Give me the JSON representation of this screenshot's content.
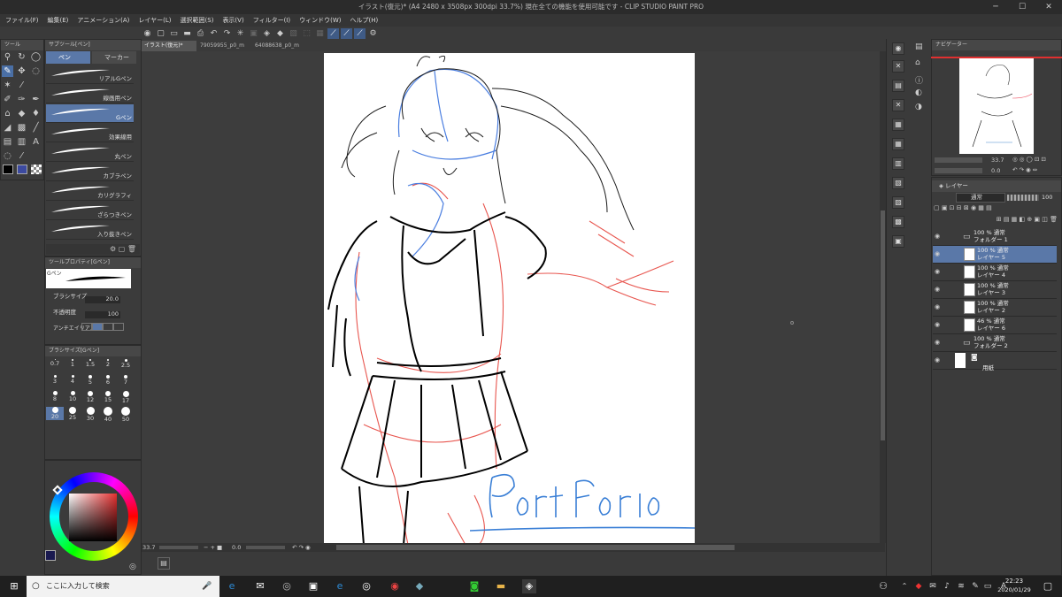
{
  "window": {
    "title": "イラスト(復元)* (A4 2480 x 3508px 300dpi 33.7%)  現在全ての機能を使用可能です - CLIP STUDIO PAINT PRO"
  },
  "menu": [
    "ファイル(F)",
    "編集(E)",
    "アニメーション(A)",
    "レイヤー(L)",
    "選択範囲(S)",
    "表示(V)",
    "フィルター(I)",
    "ウィンドウ(W)",
    "ヘルプ(H)"
  ],
  "tabs": [
    "イラスト(復元)*",
    "79059955_p0_m",
    "64088638_p0_m"
  ],
  "tool_panel": {
    "title": "ツール"
  },
  "subtool_panel": {
    "title": "サブツール[ペン]",
    "tabs": [
      "ペン",
      "マーカー"
    ],
    "brushes": [
      {
        "label": "リアルGペン",
        "selected": false
      },
      {
        "label": "線画用ペン",
        "selected": false
      },
      {
        "label": "Gペン",
        "selected": true
      },
      {
        "label": "効果線用",
        "selected": false
      },
      {
        "label": "丸ペン",
        "selected": false
      },
      {
        "label": "カブラペン",
        "selected": false
      },
      {
        "label": "カリグラフィ",
        "selected": false
      },
      {
        "label": "ざらつきペン",
        "selected": false
      },
      {
        "label": "入り抜きペン",
        "selected": false
      }
    ]
  },
  "tool_property": {
    "title": "ツールプロパティ[Gペン]",
    "preview_label": "Gペン",
    "brush_size_label": "ブラシサイズ",
    "brush_size": "20.0",
    "opacity_label": "不透明度",
    "opacity": "100",
    "antialias_label": "アンチエイリアス"
  },
  "brush_size_panel": {
    "title": "ブラシサイズ[Gペン]",
    "sizes": [
      "0.7",
      "1",
      "1.5",
      "2",
      "2.5",
      "3",
      "4",
      "5",
      "6",
      "7",
      "8",
      "10",
      "12",
      "15",
      "17",
      "20",
      "25",
      "30",
      "40",
      "50"
    ],
    "selected": "20"
  },
  "canvas": {
    "signature": "Portforio",
    "zoom": "33.7",
    "angle": "0.0"
  },
  "navigator": {
    "title": "ナビゲーター",
    "zoom": "33.7",
    "angle": "0.0"
  },
  "layer_panel": {
    "title": "レイヤー",
    "blend_mode": "通常",
    "opacity": "100",
    "layers": [
      {
        "line1": "100 % 通常",
        "line2": "フォルダー 1",
        "type": "folder",
        "selected": false
      },
      {
        "line1": "100 % 通常",
        "line2": "レイヤー 5",
        "type": "layer",
        "selected": true
      },
      {
        "line1": "100 % 通常",
        "line2": "レイヤー 4",
        "type": "layer",
        "selected": false
      },
      {
        "line1": "100 % 通常",
        "line2": "レイヤー 3",
        "type": "layer",
        "selected": false
      },
      {
        "line1": "100 % 通常",
        "line2": "レイヤー 2",
        "type": "layer",
        "selected": false
      },
      {
        "line1": "46 % 通常",
        "line2": "レイヤー 6",
        "type": "layer",
        "selected": false
      },
      {
        "line1": "100 % 通常",
        "line2": "フォルダー 2",
        "type": "folder",
        "selected": false
      },
      {
        "line1": "",
        "line2": "用紙",
        "type": "paper",
        "selected": false
      }
    ]
  },
  "taskbar": {
    "search_placeholder": "ここに入力して検索",
    "time": "22:23",
    "date": "2020/01/29",
    "ime": "A"
  },
  "colors": {
    "main": "#000000",
    "sub": "#3c4aa0",
    "accent": "#5a78a8"
  }
}
